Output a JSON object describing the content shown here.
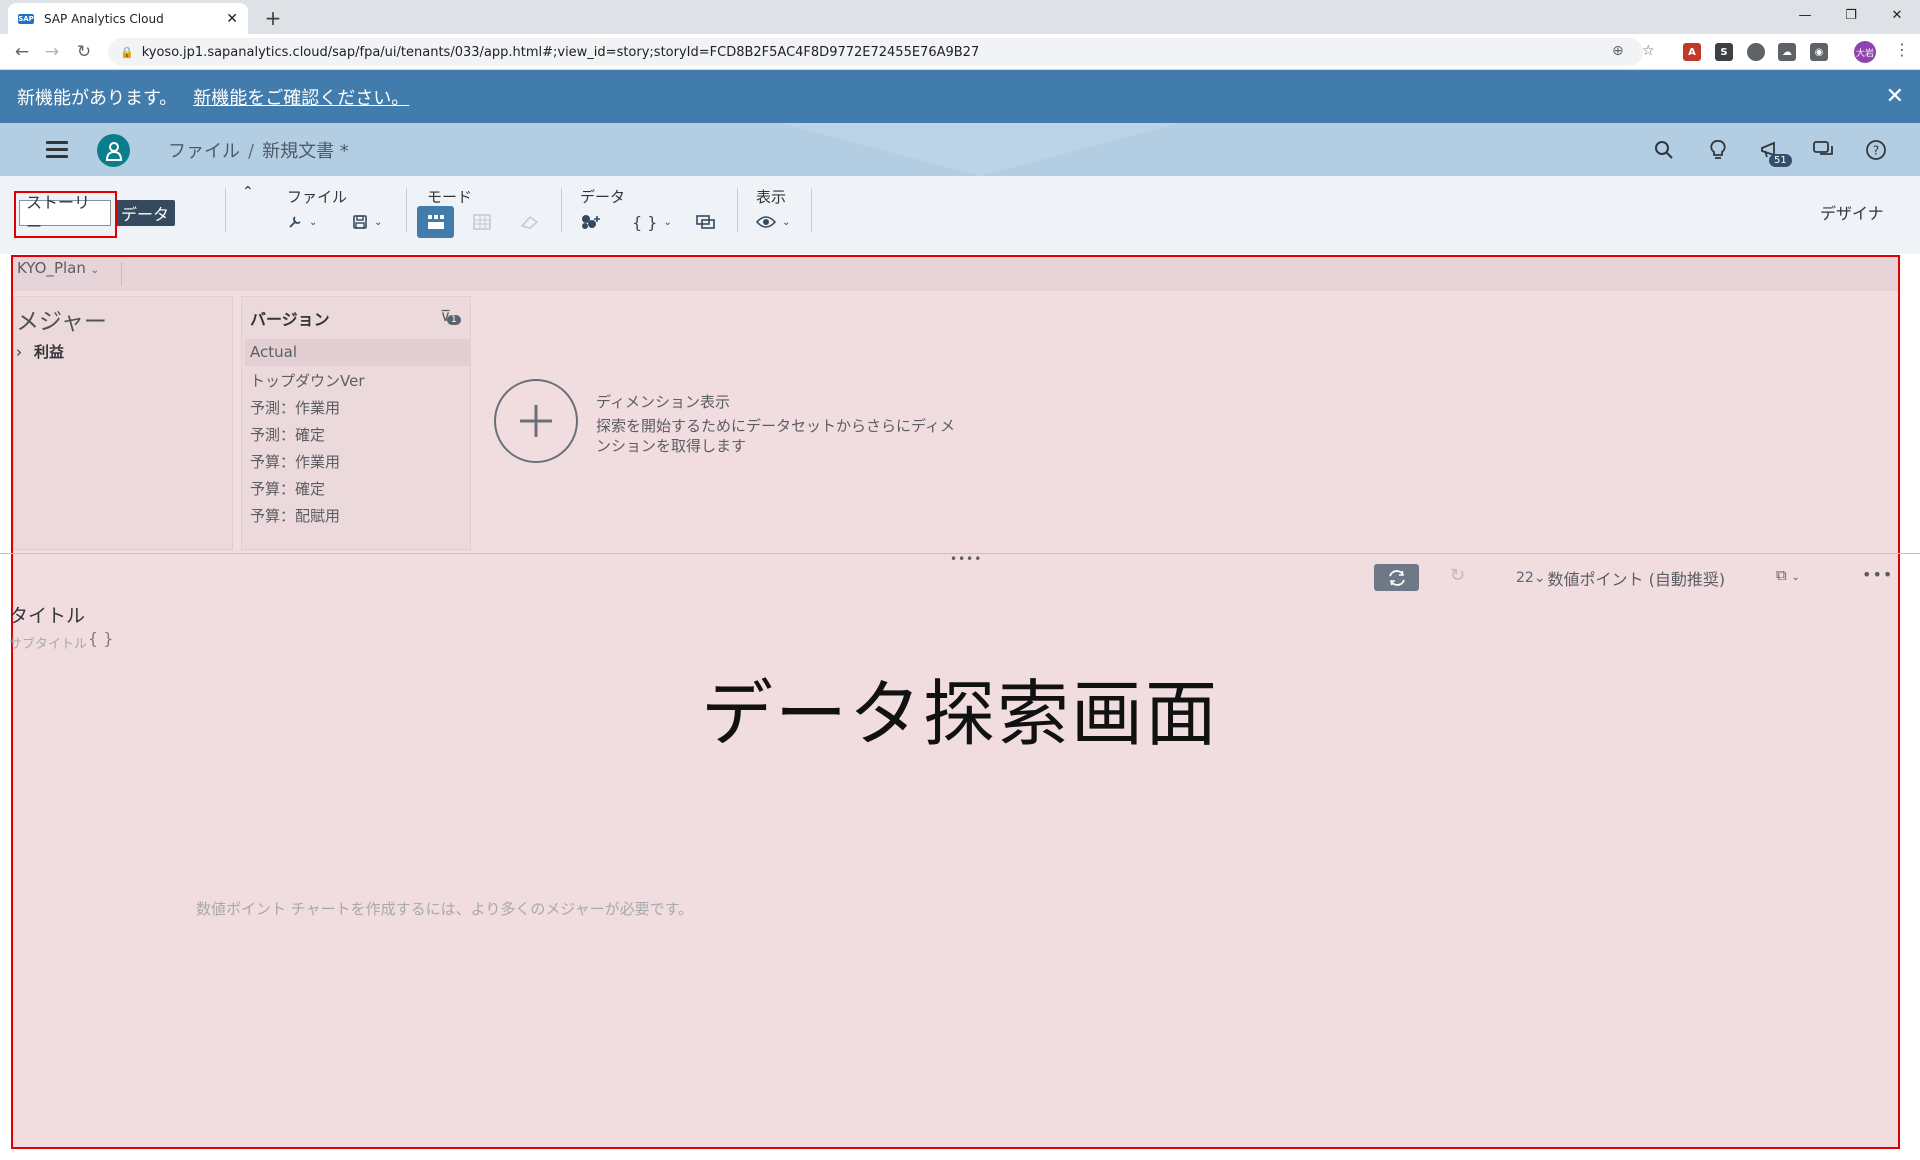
{
  "browser": {
    "tab_title": "SAP Analytics Cloud",
    "favicon_text": "SAP",
    "tab_close": "✕",
    "new_tab": "+",
    "url": "kyoso.jp1.sapanalytics.cloud/sap/fpa/ui/tenants/033/app.html#;view_id=story;storyId=FCD8B2F5AC4F8D9772E72455E76A9B27",
    "profile_initials": "大岩",
    "ext_s": "S"
  },
  "banner": {
    "message": "新機能があります。",
    "link": "新機能をご確認ください。",
    "close": "✕"
  },
  "shell": {
    "breadcrumb_root": "ファイル",
    "breadcrumb_sep": "/",
    "breadcrumb_doc": "新規文書 *",
    "notification_count": "51"
  },
  "toolbar": {
    "story_tab": "ストーリー",
    "data_tab": "データ",
    "file_label": "ファイル",
    "mode_label": "モード",
    "data_label": "データ",
    "view_label": "表示",
    "designer": "デザイナ"
  },
  "explorer": {
    "model": "KYO_Plan",
    "measures_title": "メジャー",
    "measure_item": "利益",
    "version_title": "バージョン",
    "version_filter_count": "1",
    "versions": [
      "Actual",
      "トップダウンVer",
      "予測：作業用",
      "予測：確定",
      "予算：作業用",
      "予算：確定",
      "予算：配賦用"
    ],
    "add_dimension_title": "ディメンション表示",
    "add_dimension_desc": "探索を開始するためにデータセットからさらにディメンションを取得します"
  },
  "chart": {
    "type_label": "数値ポイント (自動推奨)",
    "title": "タイトル",
    "subtitle": "サブタイトル",
    "brace": "{ }",
    "empty_message": "数値ポイント チャートを作成するには、より多くのメジャーが必要です。"
  },
  "annotation": {
    "overlay_text": "データ探索画面"
  },
  "colors": {
    "banner": "#427cac",
    "shell": "#b3cde2",
    "highlight_box": "#e00000",
    "explorer_bg": "#f1dde0"
  }
}
